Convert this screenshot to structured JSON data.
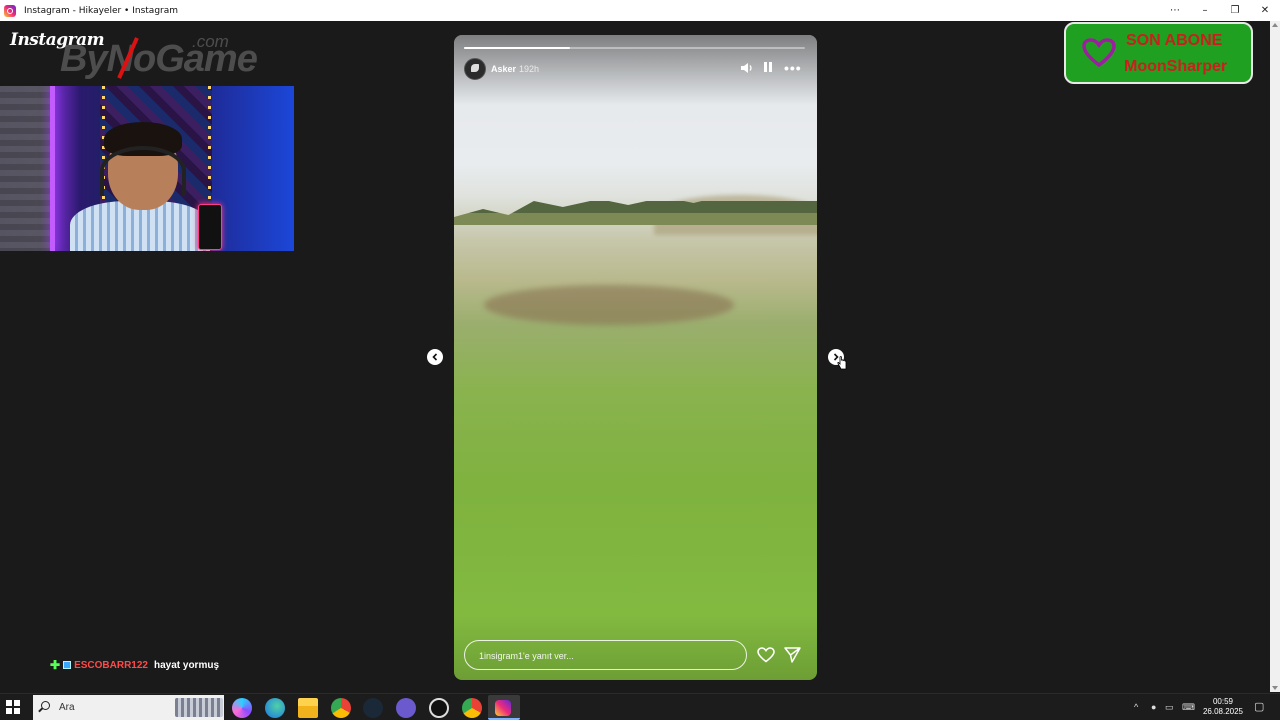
{
  "window": {
    "title": "Instagram - Hikayeler • Instagram",
    "controls": {
      "more": "⋯",
      "minimize": "–",
      "restore": "❐",
      "close": "✕"
    }
  },
  "overlay": {
    "instagram_logo": "Instagram",
    "watermark": {
      "brand": "ByNoGame",
      "suffix": ".com"
    },
    "son_abone": {
      "line1": "SON ABONE",
      "line2": "MoonSharper"
    },
    "chat": {
      "username": "ESCOBARR122",
      "message": "hayat yormuş"
    }
  },
  "story": {
    "username": "Asker",
    "time_ago": "192h",
    "progress": 0.31,
    "reply_placeholder": "1insigram1'e yanıt ver..."
  },
  "taskbar": {
    "search_placeholder": "Ara",
    "time": "00:59",
    "date": "26.08.2025"
  },
  "colors": {
    "background": "#1a1a1a",
    "son_abone_bg": "#20a020",
    "son_abone_text": "#c8201c",
    "chat_username": "#ff4a4a"
  }
}
